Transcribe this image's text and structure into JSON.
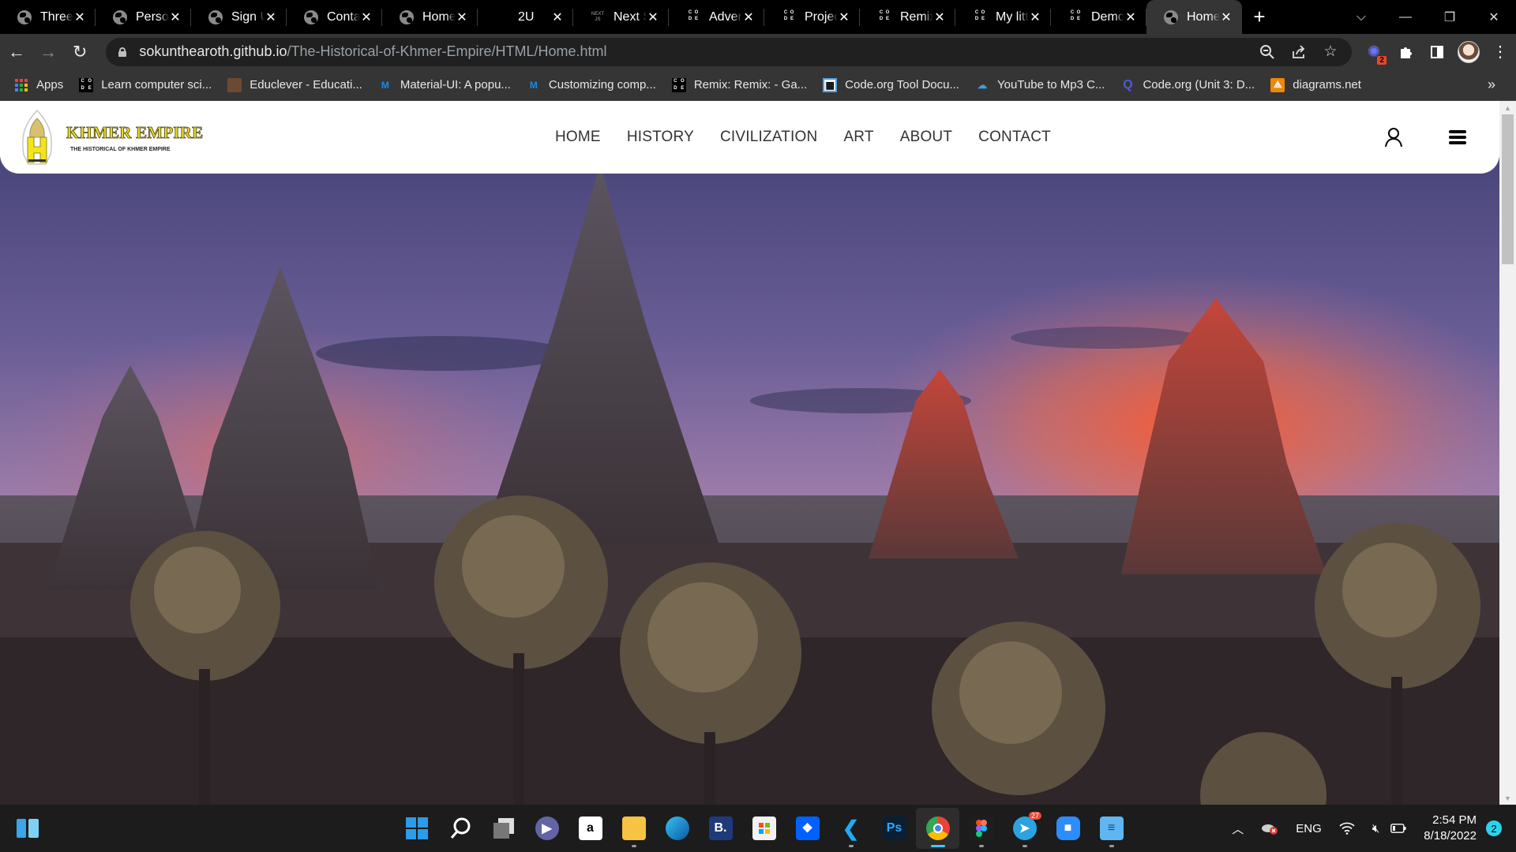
{
  "browser": {
    "tabs": [
      {
        "title": "Three",
        "icon": "globe-icon",
        "active": false
      },
      {
        "title": "Person",
        "icon": "globe-icon",
        "active": false
      },
      {
        "title": "Sign U",
        "icon": "globe-icon",
        "active": false
      },
      {
        "title": "Conta",
        "icon": "globe-icon",
        "active": false
      },
      {
        "title": "Home",
        "icon": "globe-icon",
        "active": false
      },
      {
        "title": "2U",
        "icon": "blank-icon",
        "active": false
      },
      {
        "title": "Next S",
        "icon": "next-icon",
        "active": false
      },
      {
        "title": "Adven",
        "icon": "code-org-icon",
        "active": false
      },
      {
        "title": "Projec",
        "icon": "code-org-icon",
        "active": false
      },
      {
        "title": "Remix",
        "icon": "code-org-icon",
        "active": false
      },
      {
        "title": "My littl",
        "icon": "code-org-icon",
        "active": false
      },
      {
        "title": "Demo",
        "icon": "code-org-icon",
        "active": false
      },
      {
        "title": "Home",
        "icon": "globe-icon",
        "active": true
      }
    ],
    "close_glyph": "✕",
    "new_tab_glyph": "+",
    "url_host": "sokunthearoth.github.io",
    "url_path": "/The-Historical-of-Khmer-Empire/HTML/Home.html",
    "extension_badge": "2",
    "bookmarks": [
      {
        "label": "Apps",
        "icon": "apps-grid-icon"
      },
      {
        "label": "Learn computer sci...",
        "icon": "code-org-icon"
      },
      {
        "label": "Educlever - Educati...",
        "icon": "educlever-icon"
      },
      {
        "label": "Material-UI: A popu...",
        "icon": "mui-icon"
      },
      {
        "label": "Customizing comp...",
        "icon": "mui-icon"
      },
      {
        "label": "Remix: Remix: - Ga...",
        "icon": "code-org-icon"
      },
      {
        "label": "Code.org Tool Docu...",
        "icon": "code-org-tool-icon"
      },
      {
        "label": "YouTube to Mp3 C...",
        "icon": "download-cloud-icon"
      },
      {
        "label": "Code.org (Unit 3: D...",
        "icon": "q-icon"
      },
      {
        "label": "diagrams.net",
        "icon": "diagrams-icon"
      }
    ],
    "bookmarks_overflow": "»"
  },
  "site": {
    "logo_title": "KHMER EMPIRE",
    "logo_subtitle": "THE HISTORICAL OF KHMER EMPIRE",
    "nav": [
      "HOME",
      "HISTORY",
      "CIVILIZATION",
      "ART",
      "ABOUT",
      "CONTACT"
    ],
    "colors": {
      "logo_yellow": "#e9dc21",
      "nav_text": "#333333",
      "header_bg": "#ffffff"
    }
  },
  "taskbar": {
    "apps": [
      {
        "name": "search",
        "label": ""
      },
      {
        "name": "task-view",
        "label": ""
      },
      {
        "name": "teams",
        "label": ""
      },
      {
        "name": "amazon",
        "label": "a"
      },
      {
        "name": "file-explorer",
        "label": ""
      },
      {
        "name": "edge",
        "label": ""
      },
      {
        "name": "booking",
        "label": "B."
      },
      {
        "name": "ms-store",
        "label": ""
      },
      {
        "name": "dropbox",
        "label": ""
      },
      {
        "name": "vscode",
        "label": ""
      },
      {
        "name": "photoshop",
        "label": "Ps"
      },
      {
        "name": "chrome",
        "label": ""
      },
      {
        "name": "figma",
        "label": ""
      },
      {
        "name": "telegram",
        "label": ""
      },
      {
        "name": "zoom",
        "label": ""
      },
      {
        "name": "notepad",
        "label": ""
      }
    ],
    "telegram_badge": "27",
    "language": "ENG",
    "time": "2:54 PM",
    "date": "8/18/2022",
    "notification_count": "2"
  }
}
